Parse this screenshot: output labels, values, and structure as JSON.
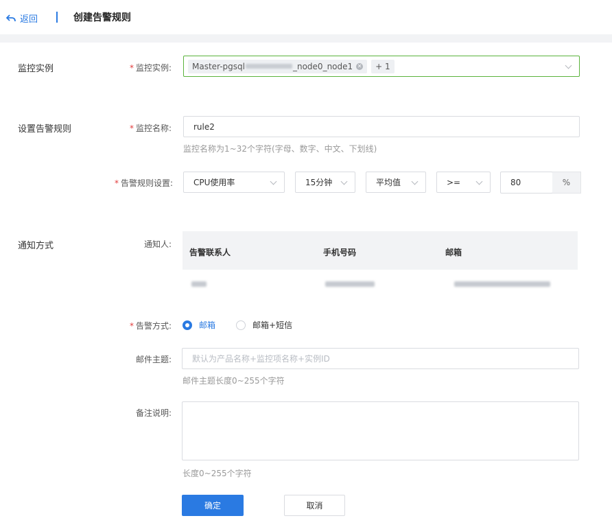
{
  "header": {
    "back_label": "返回",
    "title": "创建告警规则"
  },
  "colors": {
    "accent": "#2a7ae2",
    "focus_border": "#5ab33b",
    "required": "#e23c3c"
  },
  "monitor_instance": {
    "section_title": "监控实例",
    "label": "监控实例:",
    "selected_tag_prefix": "Master-pgsql",
    "selected_tag_suffix": "_node0_node1",
    "more_tag": "+ 1"
  },
  "rule_settings": {
    "section_title": "设置告警规则",
    "name_label": "监控名称:",
    "name_value": "rule2",
    "name_hint": "监控名称为1~32个字符(字母、数字、中文、下划线)",
    "rule_label": "告警规则设置:",
    "metric": "CPU使用率",
    "period": "15分钟",
    "statistic": "平均值",
    "operator": ">=",
    "threshold": "80",
    "unit": "%"
  },
  "notification": {
    "section_title": "通知方式",
    "recipients_label": "通知人:",
    "columns": [
      "告警联系人",
      "手机号码",
      "邮箱"
    ],
    "method_label": "告警方式:",
    "methods": [
      {
        "label": "邮箱",
        "selected": true
      },
      {
        "label": "邮箱+短信",
        "selected": false
      }
    ],
    "subject_label": "邮件主题:",
    "subject_placeholder": "默认为产品名称+监控项名称+实例ID",
    "subject_hint": "邮件主题长度0~255个字符",
    "remark_label": "备注说明:",
    "remark_hint": "长度0~255个字符"
  },
  "actions": {
    "confirm": "确定",
    "cancel": "取消"
  }
}
